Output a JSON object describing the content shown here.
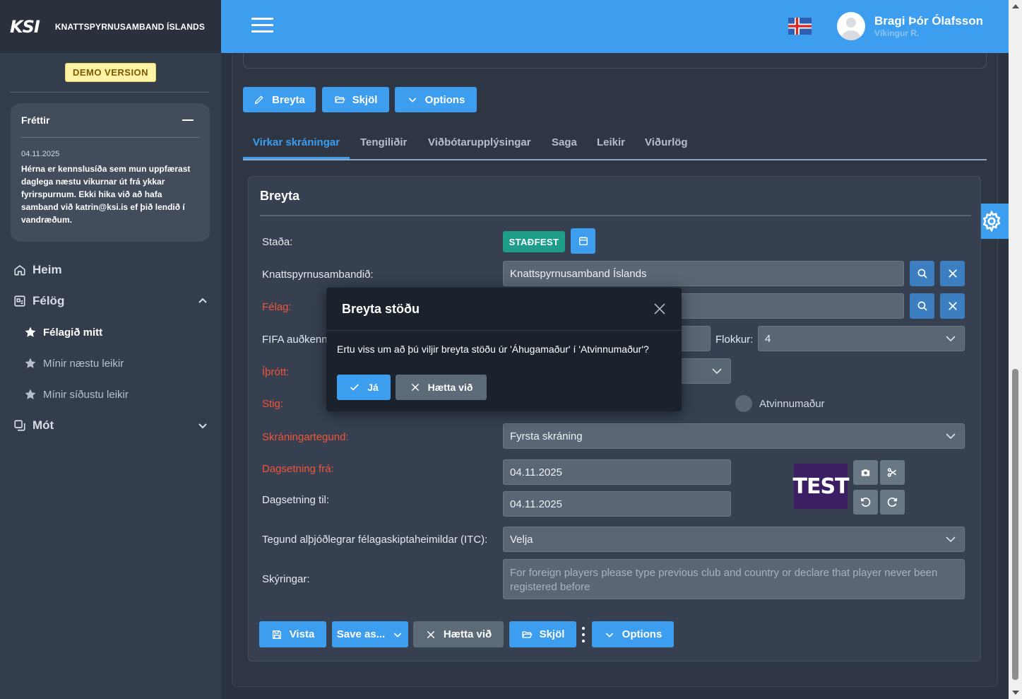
{
  "brand": {
    "logo": "KSI",
    "name": "KNATTSPYRNUSAMBAND ÍSLANDS"
  },
  "demo_badge": "DEMO VERSION",
  "news": {
    "title": "Fréttir",
    "date": "04.11.2025",
    "text": "Hérna er kennslusíða sem mun uppfærast daglega næstu vikurnar út frá ykkar fyrirspurnum. Ekki hika við að hafa samband við katrin@ksi.is ef þið lendið í vandræðum."
  },
  "nav": {
    "home": "Heim",
    "clubs": "Félög",
    "my_club": "Félagið mitt",
    "next_games": "Mínir næstu leikir",
    "last_games": "Mínir síðustu leikir",
    "tournaments": "Mót"
  },
  "user": {
    "name": "Bragi Þór Ólafsson",
    "club": "Víkingur R."
  },
  "toolbar": {
    "edit": "Breyta",
    "docs": "Skjöl",
    "options": "Options"
  },
  "tabs": [
    "Virkar skráningar",
    "Tengiliðir",
    "Viðbótarupplýsingar",
    "Saga",
    "Leikir",
    "Viðurlög"
  ],
  "form": {
    "title": "Breyta",
    "status_label": "Staða:",
    "status_value": "STAÐFEST",
    "federation_label": "Knattspyrnusambandið:",
    "federation_value": "Knattspyrnusamband Íslands",
    "club_label": "Félag:",
    "fifa_label": "FIFA auðkenni",
    "category_label": "Flokkur:",
    "category_value": "4",
    "sport_label": "Íþrótt:",
    "level_label": "Stig:",
    "level_option": "Atvinnumaður",
    "reg_type_label": "Skráningartegund:",
    "reg_type_value": "Fyrsta skráning",
    "date_from_label": "Dagsetning frá:",
    "date_from_value": "04.11.2025",
    "date_to_label": "Dagsetning til:",
    "date_to_value": "04.11.2025",
    "itc_label": "Tegund alþjóðlegrar félagaskiptaheimildar (ITC):",
    "itc_value": "Velja",
    "notes_label": "Skýringar:",
    "notes_placeholder": "For foreign players please type previous club and country or declare that player never been registered before",
    "photo_text": "TEST"
  },
  "bottom": {
    "save": "Vista",
    "save_as": "Save as...",
    "cancel": "Hætta við",
    "docs": "Skjöl",
    "options": "Options"
  },
  "modal": {
    "title": "Breyta stöðu",
    "message": "Ertu viss um að þú viljir breyta stöðu úr 'Áhugamaður' í 'Atvinnumaður'?",
    "yes": "Já",
    "cancel": "Hætta við"
  },
  "colors": {
    "accent": "#3d9ef0",
    "status_green": "#1e9e8a",
    "required": "#f0553a"
  }
}
